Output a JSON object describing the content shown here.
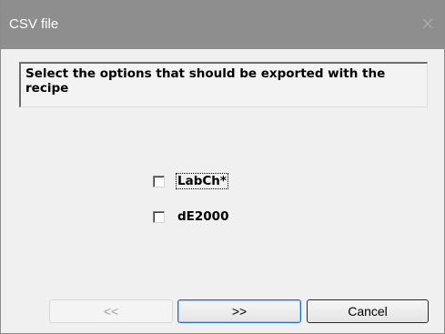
{
  "window": {
    "title": "CSV file",
    "close_icon": "close-icon"
  },
  "message": {
    "text": "Select the options that should be exported with the recipe"
  },
  "options": [
    {
      "label": "LabCh*",
      "checked": false,
      "focused": true
    },
    {
      "label": "dE2000",
      "checked": false,
      "focused": false
    }
  ],
  "buttons": {
    "back_label": "<<",
    "back_enabled": false,
    "next_label": ">>",
    "cancel_label": "Cancel"
  },
  "colors": {
    "titlebar": "#8e8e8e",
    "window_bg": "#f0f0f0",
    "default_button_border": "#1f6fd0"
  }
}
